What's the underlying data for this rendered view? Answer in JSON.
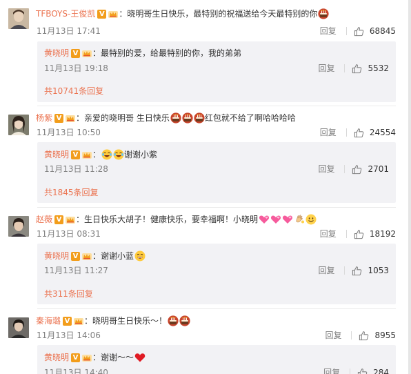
{
  "comments": [
    {
      "author": "TFBOYS-王俊凯",
      "text": "：晓明哥生日快乐，最特别的祝福送给今天最特别的你",
      "emoji_after": [
        "cake-icon"
      ],
      "time": "11月13日 17:41",
      "reply_label": "回复",
      "likes": "68845",
      "reply": {
        "author": "黄晓明",
        "text": "：最特别的爱，给最特别的你，我的弟弟",
        "time": "11月13日 19:18",
        "reply_label": "回复",
        "likes": "5532",
        "total": "共10741条回复"
      }
    },
    {
      "author": "杨紫",
      "text": "：亲爱的晓明哥 生日快乐",
      "text_after": "红包就不给了啊哈哈哈哈",
      "emoji_after": [
        "cake-icon",
        "cake-icon",
        "cake-icon"
      ],
      "time": "11月13日 10:50",
      "reply_label": "回复",
      "likes": "24554",
      "reply": {
        "author": "黄晓明",
        "text": "：",
        "text_after": "谢谢小紫",
        "emoji": [
          "laugh-tears-icon",
          "laugh-tears-icon"
        ],
        "time": "11月13日 11:28",
        "reply_label": "回复",
        "likes": "2701",
        "total": "共1845条回复"
      }
    },
    {
      "author": "赵薇",
      "text": "：生日快乐大胡子！健康快乐，要幸福啊！小晓明",
      "emoji_after": [
        "pink-hearts-icon",
        "pink-hearts-icon",
        "pink-hearts-icon",
        "clapping-hands-icon",
        "smile-icon"
      ],
      "time": "11月13日 08:31",
      "reply_label": "回复",
      "likes": "18192",
      "reply": {
        "author": "黄晓明",
        "text": "：谢谢小蓝",
        "emoji": [
          "grin-icon"
        ],
        "time": "11月13日 11:27",
        "reply_label": "回复",
        "likes": "1053",
        "total": "共311条回复"
      }
    },
    {
      "author": "秦海璐",
      "text": "：晓明哥生日快乐～！",
      "emoji_after": [
        "cake-icon",
        "cake-icon"
      ],
      "time": "11月13日 14:06",
      "reply_label": "回复",
      "likes": "8955",
      "reply": {
        "author": "黄晓明",
        "text": "：谢谢～～",
        "emoji": [
          "red-heart-icon"
        ],
        "time": "11月13日 14:40",
        "reply_label": "回复",
        "likes": "284"
      }
    }
  ],
  "badge_letter": "V",
  "colors": {
    "name": "#eb7350",
    "text": "#333333",
    "meta": "#808080",
    "reply_bg": "#f2f2f5",
    "badge": "#f29d1b"
  }
}
